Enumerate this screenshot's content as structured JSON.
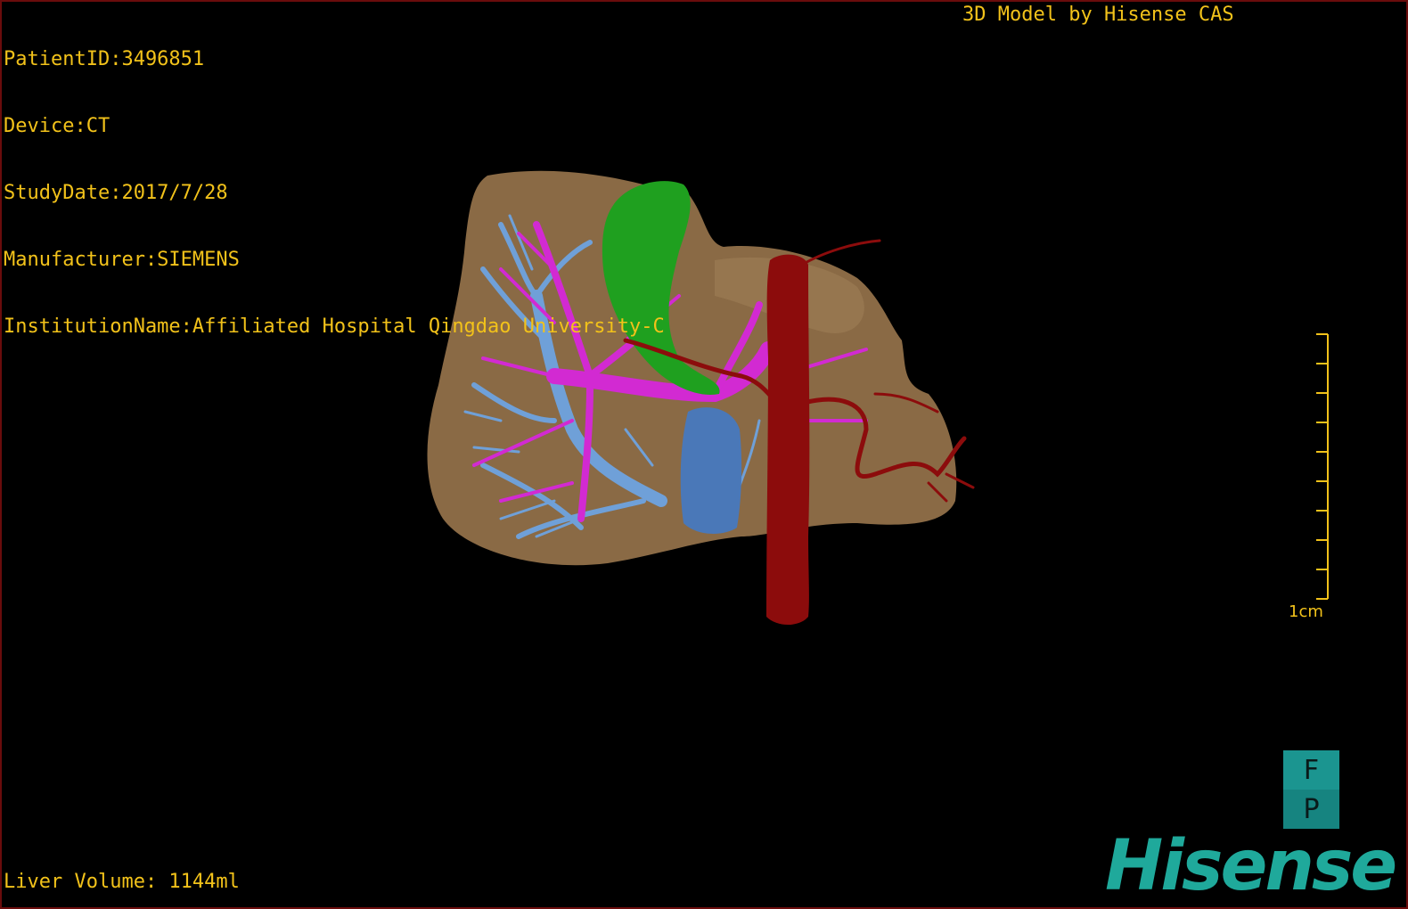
{
  "header": {
    "info_lines": [
      "PatientID:3496851",
      "Device:CT",
      "StudyDate:2017/7/28",
      "Manufacturer:SIEMENS",
      "InstitutionName:Affiliated Hospital Qingdao University-C"
    ],
    "title": "3D Model by Hisense CAS"
  },
  "footer": {
    "liver_volume": "Liver Volume: 1144ml"
  },
  "scale_bar": {
    "label": "1cm",
    "divisions": 9
  },
  "orientation_cube": {
    "top_face": "F",
    "bottom_face": "P"
  },
  "logo": {
    "text": "Hisense"
  },
  "colors": {
    "text": "#f2c21a",
    "liver": "#8a6a45",
    "gallbladder": "#1fa01f",
    "portal_vein": "#d22ad2",
    "hepatic_vein": "#6fa0d8",
    "artery": "#8c0c0c",
    "brand": "#1fa99b"
  }
}
